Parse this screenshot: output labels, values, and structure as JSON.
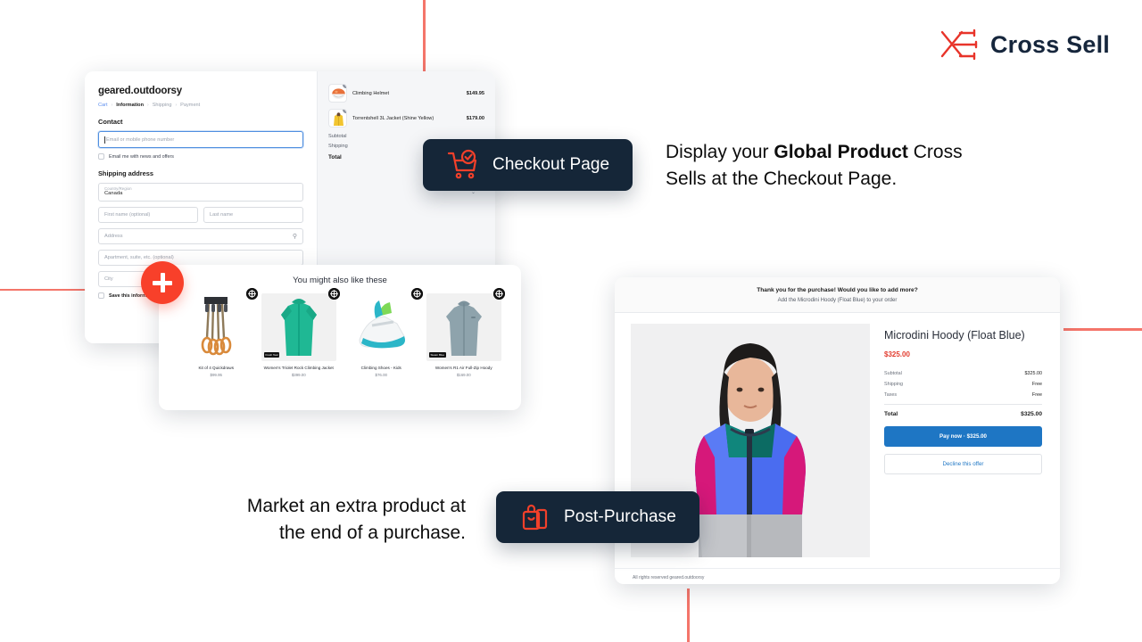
{
  "brand": {
    "name": "Cross Sell",
    "accent": "#e8342a",
    "text_color": "#16263c"
  },
  "headlines": {
    "checkout_pre": "Display your ",
    "checkout_strong": "Global Product",
    "checkout_post": " Cross Sells at the Checkout Page.",
    "post_purchase": "Market an extra product at the end of a purchase."
  },
  "badges": {
    "checkout": {
      "label": "Checkout Page",
      "icon": "cart-check-icon",
      "bg": "#152638",
      "icon_color": "#f1402a"
    },
    "post_purchase": {
      "label": "Post-Purchase",
      "icon": "shopping-bag-smile-icon",
      "bg": "#152638",
      "icon_color": "#f1402a"
    }
  },
  "checkout_mock": {
    "shop_name": "geared.outdoorsy",
    "breadcrumbs": [
      {
        "label": "Cart",
        "state": "link"
      },
      {
        "label": "Information",
        "state": "current"
      },
      {
        "label": "Shipping",
        "state": "muted"
      },
      {
        "label": "Payment",
        "state": "muted"
      }
    ],
    "contact": {
      "section_title": "Contact",
      "email_placeholder": "Email or mobile phone number",
      "newsletter_label": "Email me with news and offers"
    },
    "shipping": {
      "section_title": "Shipping address",
      "country_label": "Country/Region",
      "country_value": "Canada",
      "first_name_placeholder": "First name (optional)",
      "last_name_placeholder": "Last name",
      "address_placeholder": "Address",
      "apartment_placeholder": "Apartment, suite, etc. (optional)",
      "city_placeholder": "City",
      "save_info_label": "Save this information for next time"
    },
    "cart": {
      "items": [
        {
          "name": "Climbing Helmet",
          "price": "$149.95",
          "qty": "1"
        },
        {
          "name": "Torrentshell 3L Jacket (Shine Yellow)",
          "price": "$179.00",
          "qty": "1"
        }
      ],
      "summary": [
        {
          "label": "Subtotal",
          "value": ""
        },
        {
          "label": "Shipping",
          "value": ""
        }
      ],
      "total_label": "Total"
    }
  },
  "recommendations": {
    "title": "You might also like these",
    "add_icon": "add-circle-icon",
    "products": [
      {
        "name": "Kit of 4 Quickdraws",
        "price": "$99.95",
        "tag": ""
      },
      {
        "name": "Women's Triolet Rock Climbing Jacket",
        "price": "$399.00",
        "tag": "Fresh Teal"
      },
      {
        "name": "Climbing Shoes - Kids",
        "price": "$76.00",
        "tag": ""
      },
      {
        "name": "Women's R1 Air Full-Zip Hoody",
        "price": "$169.00",
        "tag": "Steam Blue"
      }
    ]
  },
  "post_purchase_mock": {
    "header_title": "Thank you for the purchase! Would you like to add more?",
    "header_subtitle": "Add the Microdini Hoody (Float Blue) to your order",
    "product_title": "Microdini Hoody (Float Blue)",
    "product_price": "$325.00",
    "lines": [
      {
        "label": "Subtotal",
        "value": "$325.00"
      },
      {
        "label": "Shipping",
        "value": "Free"
      },
      {
        "label": "Taxes",
        "value": "Free"
      }
    ],
    "total_label": "Total",
    "total_value": "$325.00",
    "pay_button": "Pay now · $325.00",
    "decline_button": "Decline this offer",
    "footer": "All rights reserved geared.outdoorsy",
    "pay_button_color": "#1e76c4"
  }
}
